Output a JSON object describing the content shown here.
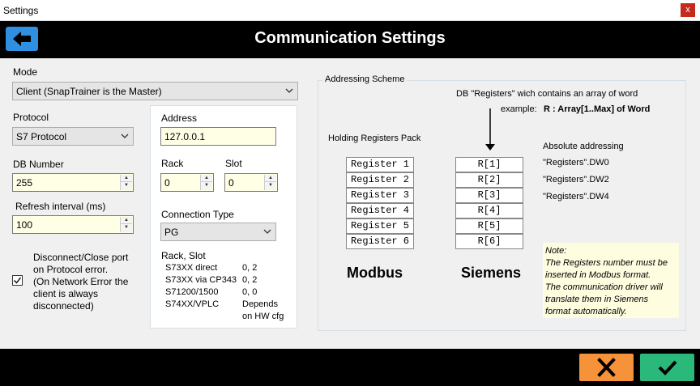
{
  "window": {
    "title": "Settings",
    "close": "x"
  },
  "header": {
    "title": "Communication Settings"
  },
  "mode": {
    "label": "Mode",
    "value": "Client (SnapTrainer is the Master)"
  },
  "protocol": {
    "label": "Protocol",
    "value": "S7 Protocol"
  },
  "db_number": {
    "label": "DB Number",
    "value": "255"
  },
  "refresh": {
    "label": "Refresh interval (ms)",
    "value": "100"
  },
  "disconnect": {
    "checked": true,
    "lines": [
      "Disconnect/Close port",
      "on Protocol error.",
      "(On Network Error the",
      "client is always",
      "disconnected)"
    ]
  },
  "address": {
    "label": "Address",
    "value": "127.0.0.1"
  },
  "rack": {
    "label": "Rack",
    "value": "0"
  },
  "slot": {
    "label": "Slot",
    "value": "0"
  },
  "connection_type": {
    "label": "Connection Type",
    "value": "PG"
  },
  "rack_slot_table": {
    "title": "Rack, Slot",
    "rows": [
      {
        "name": "S73XX direct",
        "val": "0, 2"
      },
      {
        "name": "S73XX via CP343",
        "val": "0, 2"
      },
      {
        "name": "S71200/1500",
        "val": "0, 0"
      },
      {
        "name": "S74XX/VPLC",
        "val": "Depends"
      }
    ],
    "extra": "on HW cfg"
  },
  "addressing": {
    "title": "Addressing Scheme",
    "db_text": "DB \"Registers\" wich contains an array of word",
    "example_label": "example:",
    "example_value": "R : Array[1..Max] of Word",
    "holding_label": "Holding Registers Pack",
    "absolute_label": "Absolute addressing",
    "modbus_registers": [
      "Register 1",
      "Register 2",
      "Register 3",
      "Register 4",
      "Register 5",
      "Register 6"
    ],
    "siemens_registers": [
      "R[1]",
      "R[2]",
      "R[3]",
      "R[4]",
      "R[5]",
      "R[6]"
    ],
    "absolute": [
      "\"Registers\".DW0",
      "\"Registers\".DW2",
      "\"Registers\".DW4"
    ],
    "modbus_title": "Modbus",
    "siemens_title": "Siemens",
    "note_lines": [
      "Note:",
      "The Registers number must be",
      "inserted in Modbus format.",
      "The communication driver will",
      "translate them in Siemens",
      "format automatically."
    ]
  },
  "footer": {
    "cancel_icon": "close-icon",
    "ok_icon": "check-icon"
  }
}
